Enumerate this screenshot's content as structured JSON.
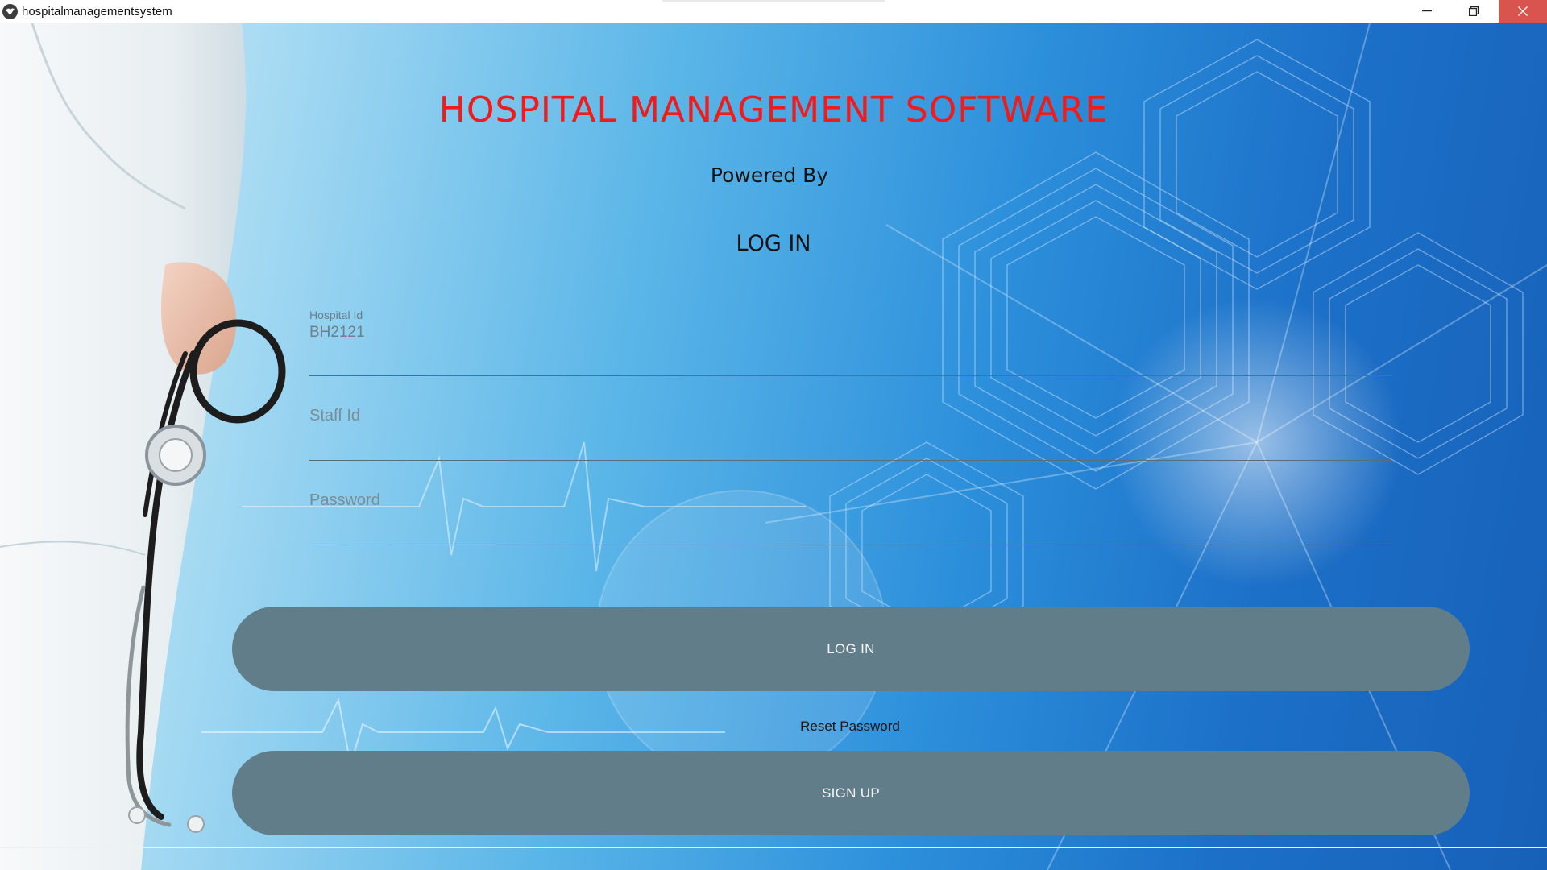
{
  "window": {
    "title": "hospitalmanagementsystem",
    "icon": "app-bird-icon",
    "controls": [
      "minimize-icon",
      "restore-icon",
      "close-icon"
    ],
    "close_color": "#d9534f"
  },
  "header": {
    "app_title": "HOSPITAL MANAGEMENT SOFTWARE",
    "app_title_color": "#ee1c1c",
    "powered_by": "Powered By",
    "login_heading": "LOG IN"
  },
  "form": {
    "hospital_id": {
      "label": "Hospital Id",
      "value": "BH2121"
    },
    "staff_id": {
      "placeholder": "Staff Id",
      "value": ""
    },
    "password": {
      "placeholder": "Password",
      "value": ""
    }
  },
  "actions": {
    "login_label": "LOG IN",
    "reset_label": "Reset Password",
    "signup_label": "SIGN UP",
    "button_color": "#627d8a"
  }
}
